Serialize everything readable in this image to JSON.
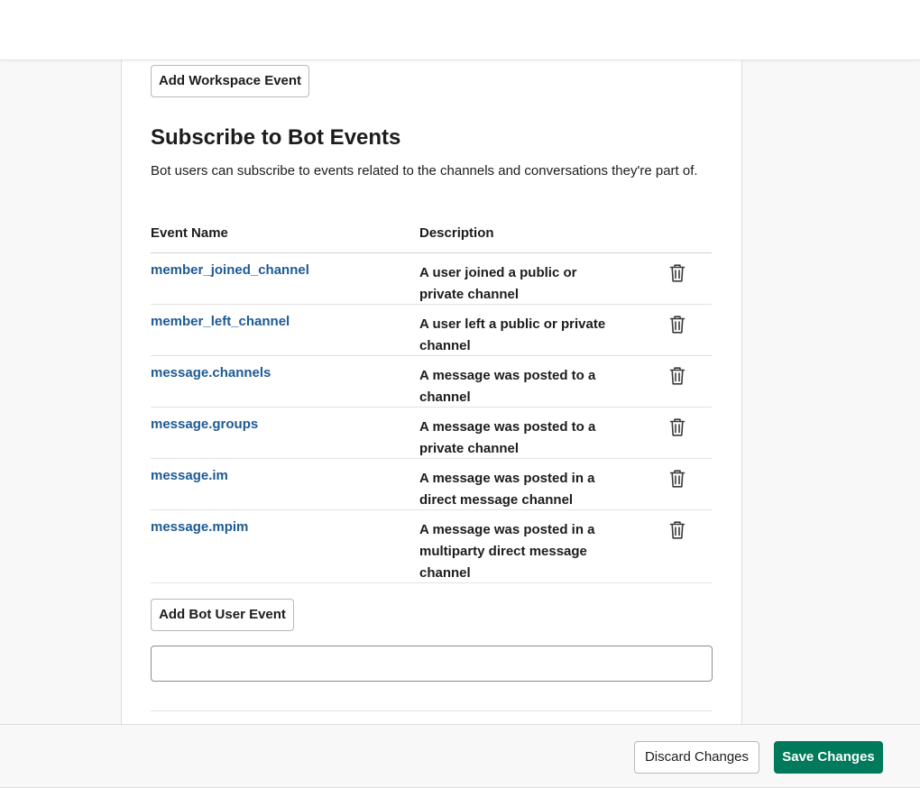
{
  "workspace_events": {
    "add_button_label": "Add Workspace Event"
  },
  "bot_events": {
    "title": "Subscribe to Bot Events",
    "description": "Bot users can subscribe to events related to the channels and conversations they're part of.",
    "columns": {
      "event_name": "Event Name",
      "description": "Description"
    },
    "rows": [
      {
        "name": "member_joined_channel",
        "description": "A user joined a public or private channel"
      },
      {
        "name": "member_left_channel",
        "description": "A user left a public or private channel"
      },
      {
        "name": "message.channels",
        "description": "A message was posted to a channel"
      },
      {
        "name": "message.groups",
        "description": "A message was posted to a private channel"
      },
      {
        "name": "message.im",
        "description": "A message was posted in a direct message channel"
      },
      {
        "name": "message.mpim",
        "description": "A message was posted in a multiparty direct message channel"
      }
    ],
    "row_icon": "trash-icon",
    "add_button_label": "Add Bot User Event",
    "input_value": "",
    "input_placeholder": ""
  },
  "footer": {
    "discard_label": "Discard Changes",
    "save_label": "Save Changes"
  },
  "colors": {
    "link": "#1d5a94",
    "primary": "#007a5a",
    "text": "#1d1c1d"
  }
}
